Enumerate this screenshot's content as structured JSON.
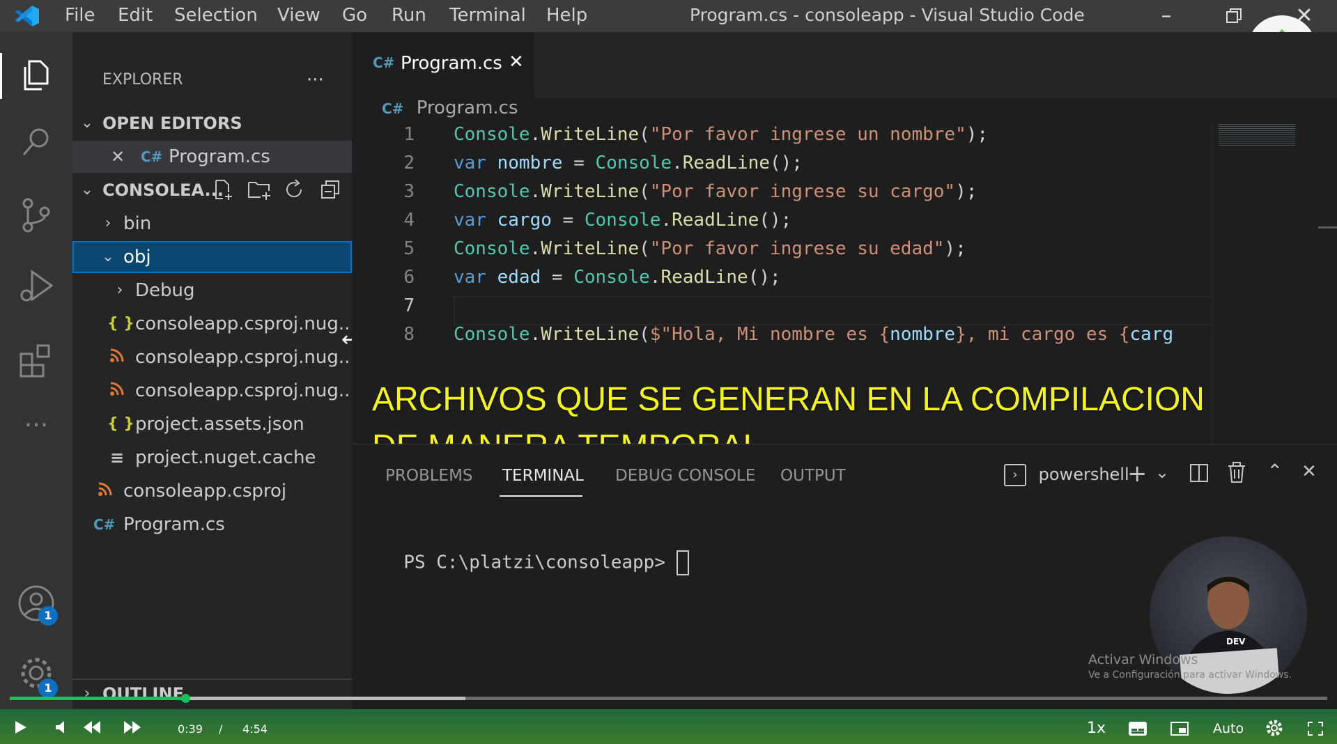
{
  "window": {
    "title": "Program.cs - consoleapp - Visual Studio Code",
    "menu": [
      "File",
      "Edit",
      "Selection",
      "View",
      "Go",
      "Run",
      "Terminal",
      "Help"
    ]
  },
  "activity_bar": {
    "accounts_badge": "1",
    "settings_badge": "1"
  },
  "sidebar": {
    "title": "EXPLORER",
    "more": "···",
    "open_editors_label": "OPEN EDITORS",
    "open_editor_file": "Program.cs",
    "project_label": "CONSOLEA...",
    "tree": [
      {
        "label": "bin"
      },
      {
        "label": "obj"
      },
      {
        "label": "Debug"
      },
      {
        "label": "consoleapp.csproj.nug...",
        "icon": "{ }"
      },
      {
        "label": "consoleapp.csproj.nug...",
        "icon": "rss"
      },
      {
        "label": "consoleapp.csproj.nug...",
        "icon": "rss"
      },
      {
        "label": "project.assets.json",
        "icon": "{ }"
      },
      {
        "label": "project.nuget.cache",
        "icon": "≡"
      },
      {
        "label": "consoleapp.csproj",
        "icon": "rss"
      },
      {
        "label": "Program.cs",
        "icon": "C#"
      }
    ],
    "outline_label": "OUTLINE"
  },
  "editor": {
    "tab_label": "Program.cs",
    "breadcrumb": "Program.cs",
    "line_numbers": [
      "1",
      "2",
      "3",
      "4",
      "5",
      "6",
      "7",
      "8"
    ],
    "lines": [
      [
        {
          "t": "Console",
          "c": "cls"
        },
        {
          "t": ".",
          "c": ""
        },
        {
          "t": "WriteLine",
          "c": "mth"
        },
        {
          "t": "(",
          "c": ""
        },
        {
          "t": "\"Por favor ingrese un nombre\"",
          "c": "str"
        },
        {
          "t": ");",
          "c": ""
        }
      ],
      [
        {
          "t": "var",
          "c": "kw"
        },
        {
          "t": " ",
          "c": ""
        },
        {
          "t": "nombre",
          "c": "var"
        },
        {
          "t": " = ",
          "c": ""
        },
        {
          "t": "Console",
          "c": "cls"
        },
        {
          "t": ".",
          "c": ""
        },
        {
          "t": "ReadLine",
          "c": "mth"
        },
        {
          "t": "();",
          "c": ""
        }
      ],
      [
        {
          "t": "Console",
          "c": "cls"
        },
        {
          "t": ".",
          "c": ""
        },
        {
          "t": "WriteLine",
          "c": "mth"
        },
        {
          "t": "(",
          "c": ""
        },
        {
          "t": "\"Por favor ingrese su cargo\"",
          "c": "str"
        },
        {
          "t": ");",
          "c": ""
        }
      ],
      [
        {
          "t": "var",
          "c": "kw"
        },
        {
          "t": " ",
          "c": ""
        },
        {
          "t": "cargo",
          "c": "var"
        },
        {
          "t": " = ",
          "c": ""
        },
        {
          "t": "Console",
          "c": "cls"
        },
        {
          "t": ".",
          "c": ""
        },
        {
          "t": "ReadLine",
          "c": "mth"
        },
        {
          "t": "();",
          "c": ""
        }
      ],
      [
        {
          "t": "Console",
          "c": "cls"
        },
        {
          "t": ".",
          "c": ""
        },
        {
          "t": "WriteLine",
          "c": "mth"
        },
        {
          "t": "(",
          "c": ""
        },
        {
          "t": "\"Por favor ingrese su edad\"",
          "c": "str"
        },
        {
          "t": ");",
          "c": ""
        }
      ],
      [
        {
          "t": "var",
          "c": "kw"
        },
        {
          "t": " ",
          "c": ""
        },
        {
          "t": "edad",
          "c": "var"
        },
        {
          "t": " = ",
          "c": ""
        },
        {
          "t": "Console",
          "c": "cls"
        },
        {
          "t": ".",
          "c": ""
        },
        {
          "t": "ReadLine",
          "c": "mth"
        },
        {
          "t": "();",
          "c": ""
        }
      ],
      [],
      [
        {
          "t": "Console",
          "c": "cls"
        },
        {
          "t": ".",
          "c": ""
        },
        {
          "t": "WriteLine",
          "c": "mth"
        },
        {
          "t": "(",
          "c": ""
        },
        {
          "t": "$\"Hola, Mi nombre es {",
          "c": "str"
        },
        {
          "t": "nombre",
          "c": "var"
        },
        {
          "t": "}, mi cargo es {",
          "c": "str"
        },
        {
          "t": "carg",
          "c": "var"
        }
      ]
    ]
  },
  "caption": "ARCHIVOS QUE SE GENERAN EN LA COMPILACION DE MANERA TEMPORAL",
  "panel": {
    "tabs": [
      "PROBLEMS",
      "TERMINAL",
      "DEBUG CONSOLE",
      "OUTPUT"
    ],
    "active_tab": "TERMINAL",
    "shell_label": "powershell",
    "prompt": "PS C:\\platzi\\consoleapp> "
  },
  "watermark": {
    "line1": "Activar Windows",
    "line2": "Ve a Configuración para activar Windows."
  },
  "video_player": {
    "current_time": "0:39",
    "separator": "/",
    "duration": "4:54",
    "speed": "1x",
    "quality": "Auto",
    "played_fraction": 0.133,
    "buffered_fraction": 0.346
  },
  "colors": {
    "titlebar": "#3c3c3c",
    "activity_bar": "#333333",
    "sidebar": "#252526",
    "editor": "#1e1e1e",
    "selection": "#094771",
    "caption": "#f5f518",
    "progress_played": "#19c15b"
  }
}
